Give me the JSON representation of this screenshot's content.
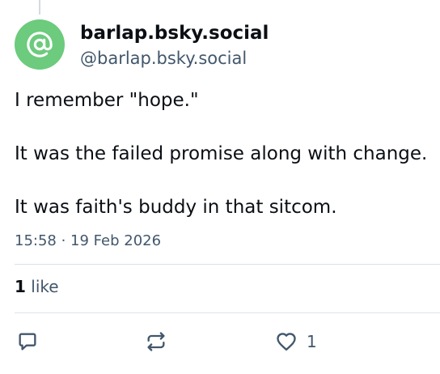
{
  "post": {
    "display_name": "barlap.bsky.social",
    "handle": "@barlap.bsky.social",
    "avatar_icon": "at-sign-icon",
    "avatar_color": "#6ccb7c",
    "paragraphs": [
      "I remember \"hope.\"",
      "It was the failed promise along with change.",
      "It was faith's buddy in that sitcom."
    ],
    "timestamp": "15:58 · 19 Feb 2026",
    "stats": {
      "like_count": "1",
      "like_label": " like"
    },
    "actions": {
      "reply_icon": "reply-icon",
      "repost_icon": "repost-icon",
      "like_icon": "heart-icon",
      "like_count": "1"
    }
  },
  "colors": {
    "text_primary": "#0b0f14",
    "text_secondary": "#42576c",
    "divider": "#dce2e8"
  }
}
